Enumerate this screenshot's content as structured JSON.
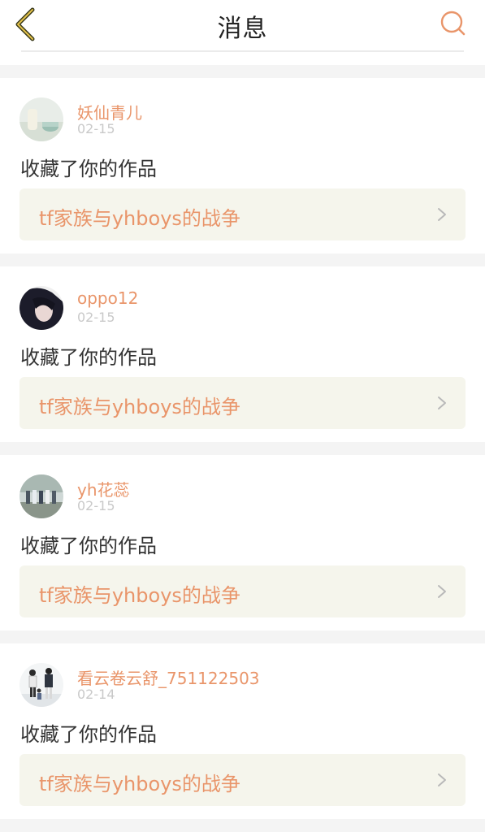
{
  "header": {
    "title": "消息",
    "back_icon": "chevron-left-icon",
    "search_icon": "search-icon",
    "accent_color": "#e9956a"
  },
  "notifications": [
    {
      "username": "妖仙青儿",
      "date": "02-15",
      "action": "收藏了你的作品",
      "work_title": "tf家族与yhboys的战争"
    },
    {
      "username": "oppo12",
      "date": "02-15",
      "action": "收藏了你的作品",
      "work_title": "tf家族与yhboys的战争"
    },
    {
      "username": "yh花蕊",
      "date": "02-15",
      "action": "收藏了你的作品",
      "work_title": "tf家族与yhboys的战争"
    },
    {
      "username": "看云卷云舒_751122503",
      "date": "02-14",
      "action": "收藏了你的作品",
      "work_title": "tf家族与yhboys的战争"
    }
  ]
}
